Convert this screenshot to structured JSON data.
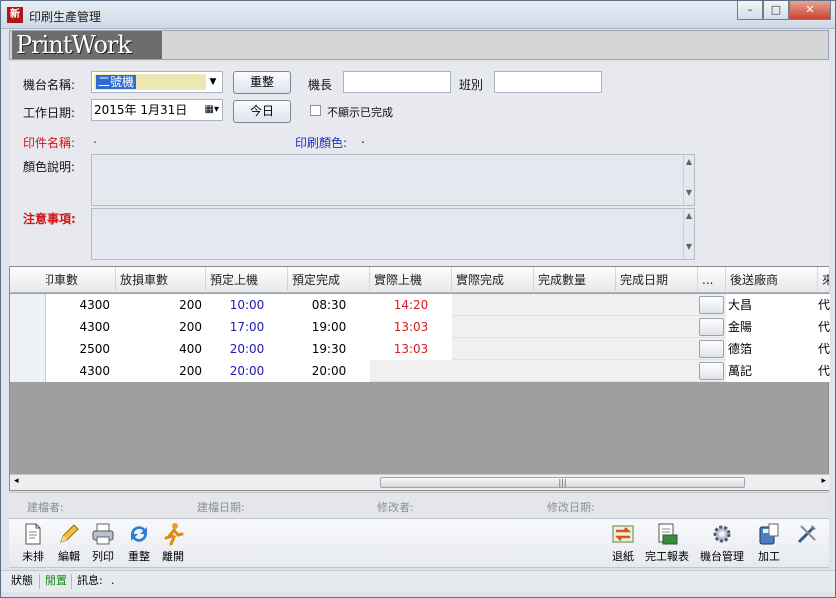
{
  "window": {
    "title": "印刷生產管理",
    "app_icon_text": "新",
    "minimize": "–",
    "maximize": "□",
    "close": "✕"
  },
  "banner": {
    "logo_text": "PrintWork"
  },
  "form": {
    "machine_label": "機台名稱:",
    "machine_value": "二號機",
    "reset_button": "重整",
    "captain_label": "機長",
    "captain_value": "",
    "shift_label": "班別",
    "shift_value": "",
    "date_label": "工作日期:",
    "date_value": "2015年  1月31日",
    "today_button": "今日",
    "hide_done_label": "不顯示已完成",
    "print_name_label": "印件名稱:",
    "print_name_value": ".",
    "print_color_label": "印刷顏色:",
    "print_color_value": ".",
    "color_desc_label": "顏色說明:",
    "notes_label": "注意事項:"
  },
  "grid": {
    "columns": [
      "印車數",
      "放損車數",
      "預定上機",
      "預定完成",
      "實際上機",
      "實際完成",
      "完成數量",
      "完成日期",
      "...",
      "後送廠商",
      "來"
    ],
    "rows": [
      {
        "qty": "4300",
        "spoil": "200",
        "plan_start": "10:00",
        "plan_end": "08:30",
        "act_start": "14:20",
        "vendor": "大昌",
        "extra": "代"
      },
      {
        "qty": "4300",
        "spoil": "200",
        "plan_start": "17:00",
        "plan_end": "19:00",
        "act_start": "13:03",
        "vendor": "金陽",
        "extra": "代"
      },
      {
        "qty": "2500",
        "spoil": "400",
        "plan_start": "20:00",
        "plan_end": "19:30",
        "act_start": "13:03",
        "vendor": "德箔",
        "extra": "代"
      },
      {
        "qty": "4300",
        "spoil": "200",
        "plan_start": "20:00",
        "plan_end": "20:00",
        "act_start": "",
        "vendor": "萬記",
        "extra": "代"
      }
    ],
    "scroll_grip": "|||"
  },
  "audit": {
    "created_by": "建檔者:",
    "created_on": "建檔日期:",
    "modified_by": "修改者:",
    "modified_on": "修改日期:"
  },
  "toolbar": {
    "left": [
      "未排",
      "編輯",
      "列印",
      "重整",
      "離開"
    ],
    "right": [
      "退紙",
      "完工報表",
      "機台管理",
      "加工",
      ""
    ]
  },
  "status": {
    "state_label": "狀態",
    "state_value": "閒置",
    "message_label": "訊息:",
    "message_value": "."
  },
  "colors": {
    "plan_start": "#1b1bb0",
    "act_start": "#d81c1c",
    "label_red": "#d01515",
    "label_blue": "#2030c0",
    "state_green": "#1a8a1a"
  }
}
